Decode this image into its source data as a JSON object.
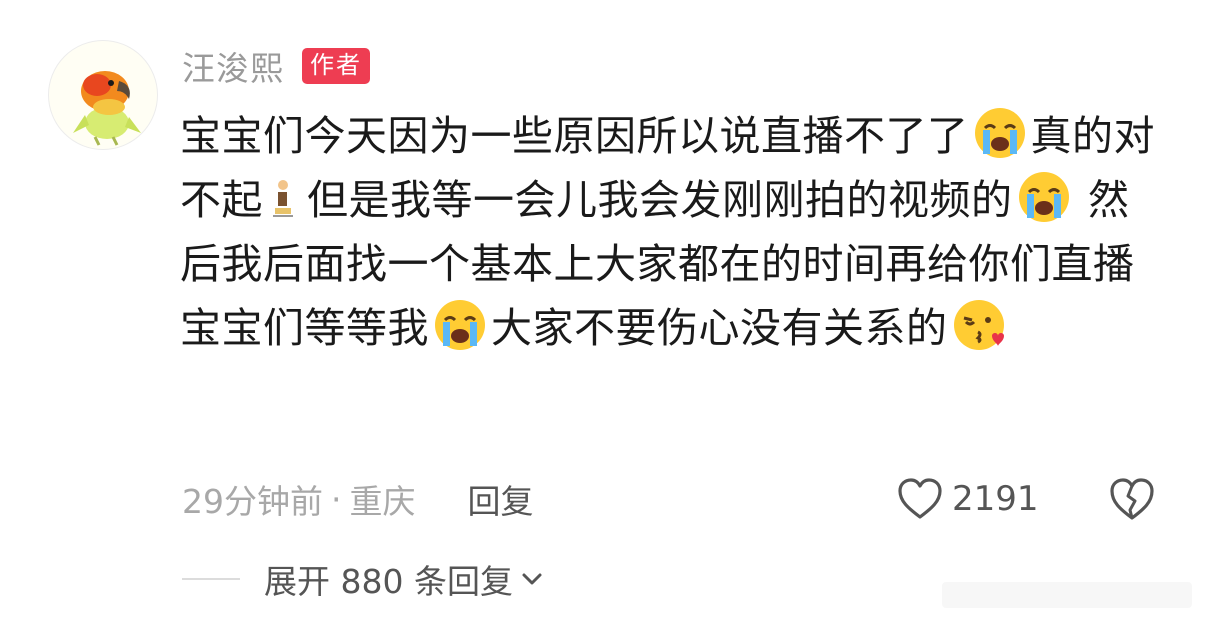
{
  "comment": {
    "username": "汪浚熙",
    "badge": "作者",
    "text_segments": [
      "宝宝们今天因为一些原因所以说直播不了了",
      "真的对不起",
      "但是我等一会儿我会发刚刚拍的视频的",
      " 然后我后面找一个基本上大家都在的时间再给你们直播宝宝们等等我",
      "大家不要伤心没有关系的"
    ],
    "emojis": [
      "loudly-crying-face",
      "person-kneeling",
      "loudly-crying-face",
      "loudly-crying-face",
      "face-blowing-kiss"
    ],
    "time": "29分钟前",
    "separator": "·",
    "location": "重庆",
    "reply_label": "回复",
    "likes": "2191",
    "expand_label": "展开 880 条回复"
  },
  "icons": {
    "avatar": "parrot-avatar",
    "like": "heart-outline-icon",
    "dislike": "broken-heart-icon",
    "expand": "chevron-down-icon"
  },
  "colors": {
    "badge": "#ee3d52",
    "text": "#1a1a1a",
    "muted": "#a8a8a8"
  }
}
